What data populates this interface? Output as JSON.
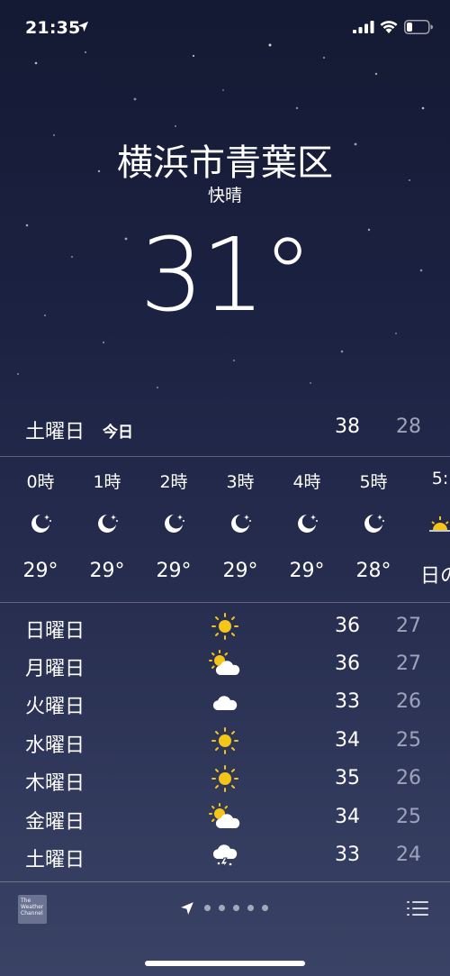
{
  "status_bar": {
    "time": "21:35"
  },
  "header": {
    "city": "横浜市青葉区",
    "condition": "快晴",
    "temperature": "31°"
  },
  "today": {
    "day": "土曜日",
    "label": "今日",
    "high": "38",
    "low": "28"
  },
  "hourly": [
    {
      "time": "0時",
      "icon": "moon-stars-icon",
      "temp": "29°"
    },
    {
      "time": "1時",
      "icon": "moon-stars-icon",
      "temp": "29°"
    },
    {
      "time": "2時",
      "icon": "moon-stars-icon",
      "temp": "29°"
    },
    {
      "time": "3時",
      "icon": "moon-stars-icon",
      "temp": "29°"
    },
    {
      "time": "4時",
      "icon": "moon-stars-icon",
      "temp": "29°"
    },
    {
      "time": "5時",
      "icon": "moon-stars-icon",
      "temp": "28°"
    },
    {
      "time": "5:",
      "icon": "sunrise-icon",
      "temp": "日の"
    }
  ],
  "daily": [
    {
      "day": "日曜日",
      "icon": "sun-icon",
      "high": "36",
      "low": "27"
    },
    {
      "day": "月曜日",
      "icon": "partly-cloudy-icon",
      "high": "36",
      "low": "27"
    },
    {
      "day": "火曜日",
      "icon": "cloud-icon",
      "high": "33",
      "low": "26"
    },
    {
      "day": "水曜日",
      "icon": "sun-icon",
      "high": "34",
      "low": "25"
    },
    {
      "day": "木曜日",
      "icon": "sun-icon",
      "high": "35",
      "low": "26"
    },
    {
      "day": "金曜日",
      "icon": "partly-cloudy-icon",
      "high": "34",
      "low": "25"
    },
    {
      "day": "土曜日",
      "icon": "thunderstorm-icon",
      "high": "33",
      "low": "24"
    }
  ],
  "footer": {
    "logo_text": "The Weather Channel",
    "page_count": 5
  },
  "colors": {
    "background_top": "#141a33",
    "background_bottom": "#3a4265",
    "sun": "#f5c518",
    "low_temp": "#9ea3bd"
  }
}
